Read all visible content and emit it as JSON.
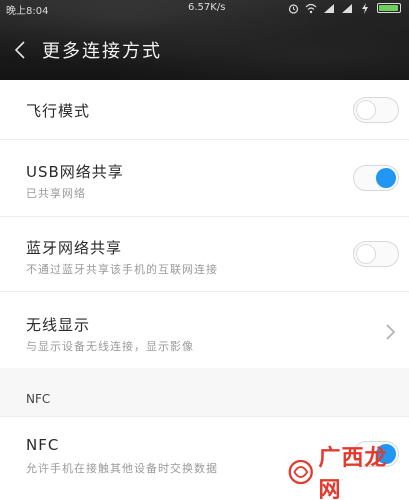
{
  "status_bar": {
    "time": "晚上8:04",
    "speed": "6.57K/s"
  },
  "header": {
    "title": "更多连接方式"
  },
  "settings": {
    "airplane_mode": {
      "title": "飞行模式",
      "enabled": false
    },
    "usb_tethering": {
      "title": "USB网络共享",
      "subtitle": "已共享网络",
      "enabled": true
    },
    "bluetooth_tethering": {
      "title": "蓝牙网络共享",
      "subtitle": "不通过蓝牙共享该手机的互联网连接",
      "enabled": false
    },
    "wireless_display": {
      "title": "无线显示",
      "subtitle": "与显示设备无线连接，显示影像"
    }
  },
  "nfc_section": {
    "label": "NFC",
    "nfc": {
      "title": "NFC",
      "subtitle": "允许手机在接触其他设备时交换数据",
      "enabled": true
    }
  },
  "watermark": {
    "text": "广西龙网"
  },
  "colors": {
    "accent": "#2196f3",
    "header_bg": "#1c1c1c",
    "watermark": "#e23a2e"
  }
}
